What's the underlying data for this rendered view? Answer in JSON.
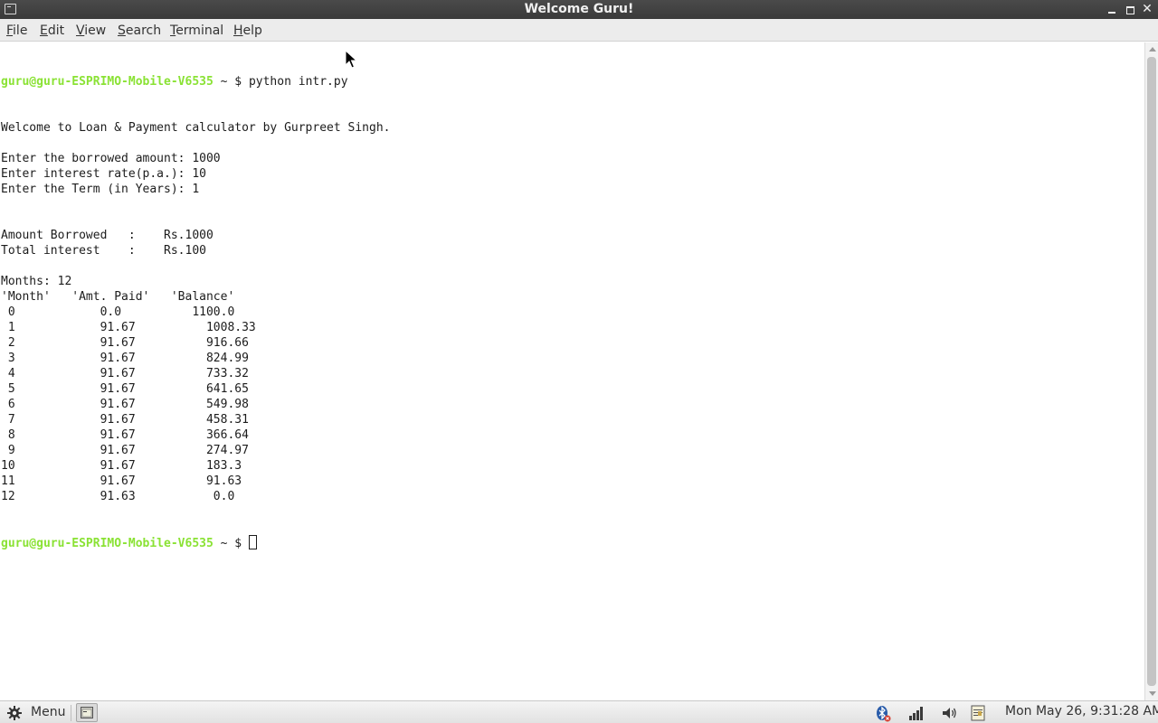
{
  "window": {
    "title": "Welcome Guru!"
  },
  "menubar": {
    "items": [
      {
        "label": "File",
        "mnemonic": "F",
        "rest": "ile"
      },
      {
        "label": "Edit",
        "mnemonic": "E",
        "rest": "dit"
      },
      {
        "label": "View",
        "mnemonic": "V",
        "rest": "iew"
      },
      {
        "label": "Search",
        "mnemonic": "S",
        "rest": "earch"
      },
      {
        "label": "Terminal",
        "mnemonic": "T",
        "rest": "erminal"
      },
      {
        "label": "Help",
        "mnemonic": "H",
        "rest": "elp"
      }
    ]
  },
  "terminal": {
    "prompt_user": "guru@guru-ESPRIMO-Mobile-V6535",
    "prompt_path": " ~ $ ",
    "command": "python intr.py",
    "output_lines": [
      "Welcome to Loan & Payment calculator by Gurpreet Singh.",
      "",
      "Enter the borrowed amount: 1000",
      "Enter interest rate(p.a.): 10",
      "Enter the Term (in Years): 1",
      "",
      "",
      "Amount Borrowed   :    Rs.1000",
      "Total interest    :    Rs.100",
      "",
      "Months: 12",
      "'Month'   'Amt. Paid'   'Balance'",
      " 0            0.0          1100.0",
      " 1            91.67          1008.33",
      " 2            91.67          916.66",
      " 3            91.67          824.99",
      " 4            91.67          733.32",
      " 5            91.67          641.65",
      " 6            91.67          549.98",
      " 7            91.67          458.31",
      " 8            91.67          366.64",
      " 9            91.67          274.97",
      "10            91.67          183.3",
      "11            91.67          91.63",
      "12            91.63           0.0"
    ]
  },
  "panel": {
    "menu_label": "Menu",
    "clock": "Mon May 26,  9:31:28 AM"
  },
  "colors": {
    "prompt": "#8ae234",
    "titlebar": "#3f3f3f",
    "terminal_bg": "#ffffff"
  }
}
